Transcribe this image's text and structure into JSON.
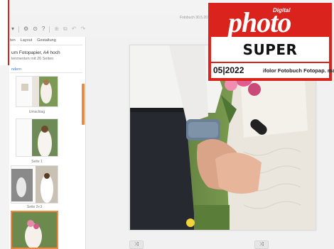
{
  "window": {
    "title": "Fotobuch 30.5.201"
  },
  "toolbar": {
    "dropdown_icon": "chevron-down-icon",
    "icons": [
      "grid-icon",
      "settings-icon",
      "help-icon",
      "zoom-icon",
      "copy-icon",
      "undo-icon",
      "redo-icon"
    ]
  },
  "sidebar": {
    "tabs": [
      "Gestaltung",
      "Layout",
      "Gestaltung"
    ],
    "tab_labels": [
      "ten",
      "Layout",
      "Gestaltung"
    ],
    "product_title": "um Fotopapier, A4 hoch",
    "product_sub": "lenmenten mit 26 Seiten",
    "link": "ndern",
    "thumbs": [
      {
        "label": "Umschlag"
      },
      {
        "label": "Seite 1"
      },
      {
        "label": "Seite 2+3"
      },
      {
        "label": ""
      }
    ]
  },
  "canvas": {
    "shuffle_left": "⤨",
    "shuffle_right": "⤨"
  },
  "badge": {
    "brand_small": "Digital",
    "brand": "photo",
    "rating": "SUPER",
    "issue": "05|2022",
    "product": "ifolor Fotobuch Fotopap. matt",
    "accent": "#d9231c"
  }
}
